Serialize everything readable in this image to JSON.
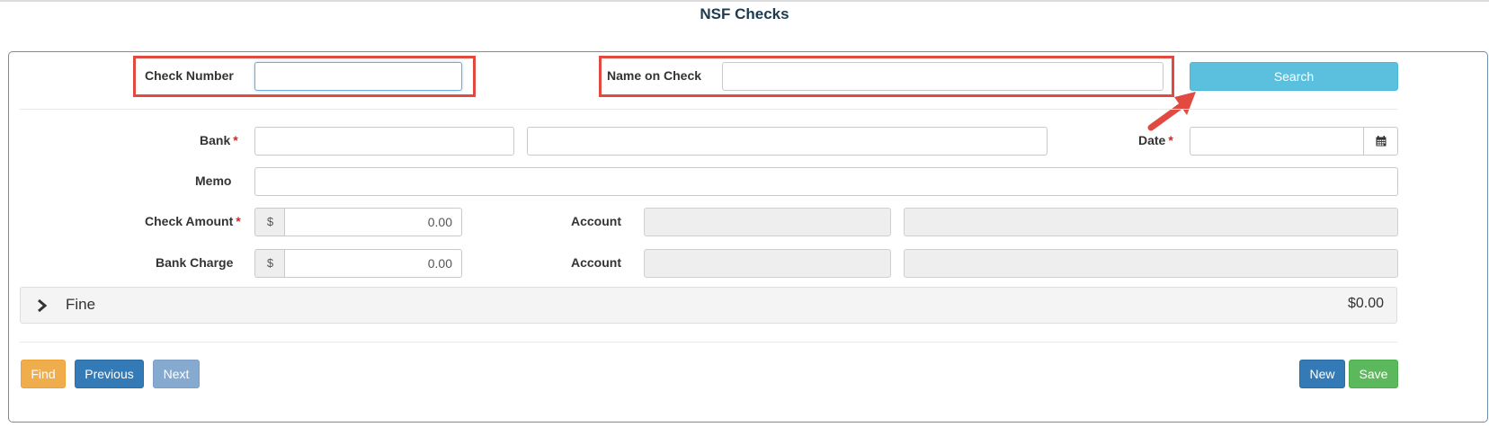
{
  "page": {
    "title": "NSF Checks"
  },
  "search": {
    "check_number_label": "Check Number",
    "check_number_value": "",
    "name_on_check_label": "Name on Check",
    "name_on_check_value": "",
    "search_button": "Search"
  },
  "form": {
    "bank_label": "Bank",
    "bank_code": "",
    "bank_name": "",
    "date_label": "Date",
    "date_value": "",
    "memo_label": "Memo",
    "memo_value": "",
    "check_amount_label": "Check Amount",
    "currency_symbol": "$",
    "check_amount_value": "0.00",
    "check_account_label": "Account",
    "bank_charge_label": "Bank Charge",
    "bank_charge_value": "0.00",
    "charge_account_label": "Account",
    "required_marker": "*"
  },
  "fine": {
    "label": "Fine",
    "amount": "$0.00"
  },
  "footer": {
    "find": "Find",
    "previous": "Previous",
    "next": "Next",
    "new": "New",
    "save": "Save"
  },
  "icons": {
    "calendar": "calendar-icon",
    "expand": "chevron-right-icon",
    "arrow": "arrow-annotation"
  },
  "colors": {
    "highlight": "#e04a41",
    "search": "#5bc0de",
    "find": "#f0ad4e",
    "primary": "#337ab7",
    "success": "#5cb85c"
  }
}
